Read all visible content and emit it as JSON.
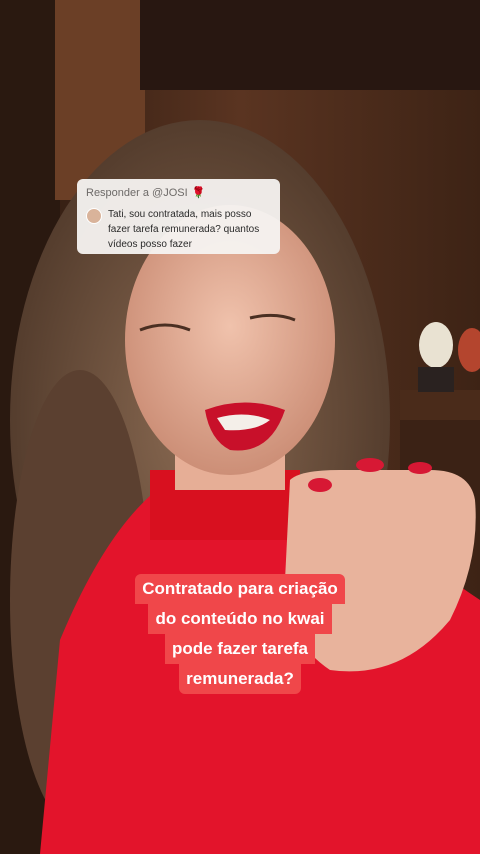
{
  "reply_card": {
    "prefix": "Responder a @JOSI",
    "emoji": "🌹",
    "text": "Tati, sou contratada, mais posso fazer tarefa remunerada? quantos vídeos posso fazer"
  },
  "caption": {
    "lines": [
      "Contratado para criação",
      "do conteúdo no kwai",
      "pode fazer tarefa",
      "remunerada?"
    ]
  }
}
